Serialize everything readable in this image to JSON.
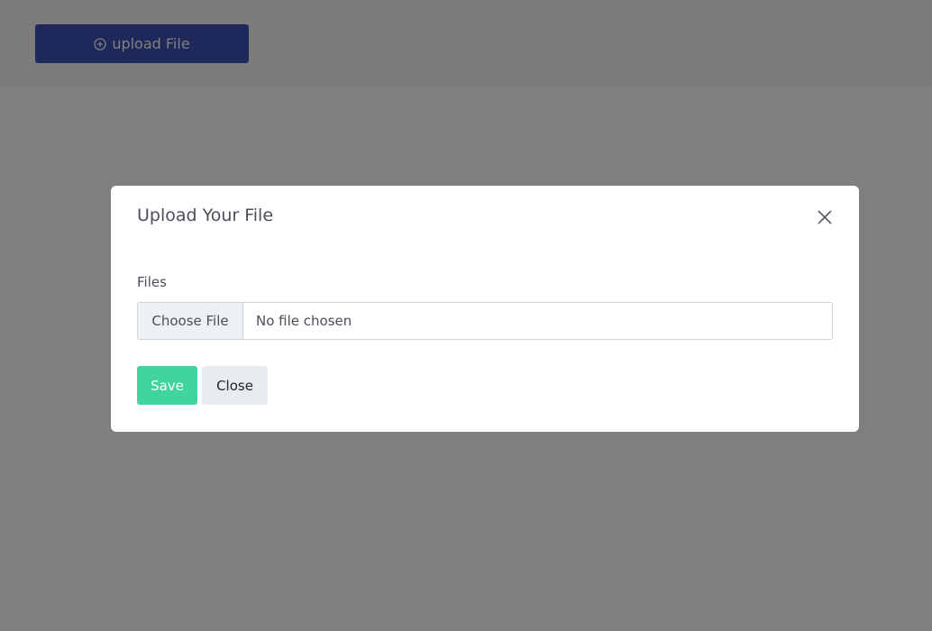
{
  "header": {
    "upload_button": {
      "label": "upload File",
      "icon": "plus-circle-icon",
      "color": "#3f51b5"
    }
  },
  "modal": {
    "title": "Upload Your File",
    "close_icon": "close-icon",
    "field_label": "Files",
    "file_input": {
      "button_label": "Choose File",
      "status": "No file chosen"
    },
    "save_label": "Save",
    "save_color": "#40d49f",
    "close_label": "Close"
  }
}
